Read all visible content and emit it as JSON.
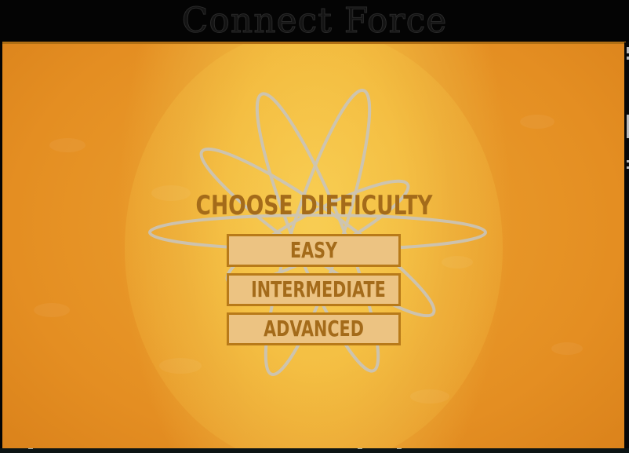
{
  "window": {
    "title": "Connect Force"
  },
  "menu": {
    "heading": "CHOOSE DIFFICULTY",
    "options": [
      {
        "label": "EASY"
      },
      {
        "label": "INTERMEDIATE"
      },
      {
        "label": "ADVANCED"
      }
    ]
  },
  "decor": {
    "background_icon": "atom-icon"
  },
  "colors": {
    "frame": "#040404",
    "background_orange": "#e48e22",
    "center_glow": "#f6c84a",
    "text_brown": "#a46b1a",
    "button_fill": "#ecc382",
    "button_border": "#b87a19",
    "atom_outline": "#c9c4bb"
  }
}
